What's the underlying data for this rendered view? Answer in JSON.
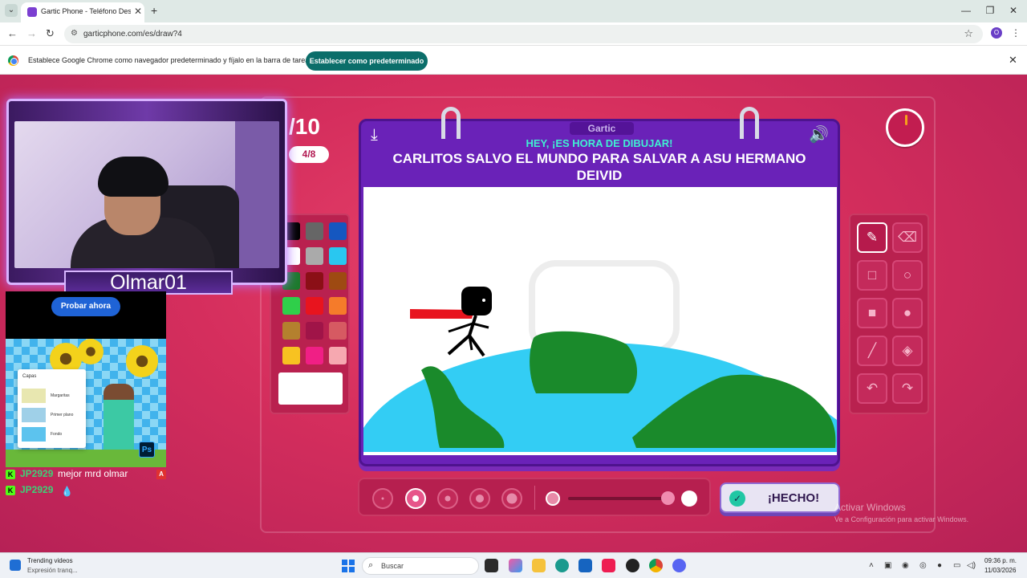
{
  "browser": {
    "tab_title": "Gartic Phone - Teléfono Descon",
    "url": "garticphone.com/es/draw?4",
    "profile_initial": "O",
    "infobar_text": "Establece Google Chrome como navegador predeterminado y fíjalo en la barra de tareas",
    "infobar_button": "Establecer como predeterminado"
  },
  "game": {
    "round": "/10",
    "progress": "4/8",
    "logo": "Gartic",
    "hint": "HEY, ¡ES HORA DE DIBUJAR!",
    "sentence": "CARLITOS SALVO EL MUNDO PARA SALVAR A ASU HERMANO DEIVID",
    "done_button": "¡HECHO!",
    "palette_colors": [
      "#000000",
      "#666666",
      "#1557c0",
      "#ffffff",
      "#aaaaaa",
      "#29c7f0",
      "#1c7a2c",
      "#8b0f16",
      "#9e4a12",
      "#2fcf4a",
      "#e8141e",
      "#f57b2a",
      "#b4802e",
      "#a01448",
      "#d65a62",
      "#f7c221",
      "#f01f85",
      "#f6a8b0"
    ],
    "tools": [
      "pencil-icon",
      "eraser-icon",
      "rectangle-outline-icon",
      "circle-outline-icon",
      "rectangle-fill-icon",
      "circle-fill-icon",
      "line-icon",
      "bucket-icon",
      "undo-icon",
      "redo-icon"
    ]
  },
  "stream": {
    "streamer_name": "Olmar01",
    "probar_button": "Probar ahora",
    "ad_layers_chip": "Capas",
    "ad_layers": [
      "Margaritas",
      "Primer plano",
      "Fondo"
    ],
    "ad_badge": "Ps",
    "chat": [
      {
        "user": "JP2929",
        "message": "mejor mrd olmar"
      },
      {
        "user": "JP2929",
        "message": ""
      }
    ]
  },
  "watermark": {
    "title": "Activar Windows",
    "subtitle": "Ve a Configuración para activar Windows."
  },
  "taskbar": {
    "news_title": "Trending videos",
    "news_sub": "Expresión tranq...",
    "search_placeholder": "Buscar",
    "time": "09:36 p. m.",
    "date": "11/03/2026"
  }
}
